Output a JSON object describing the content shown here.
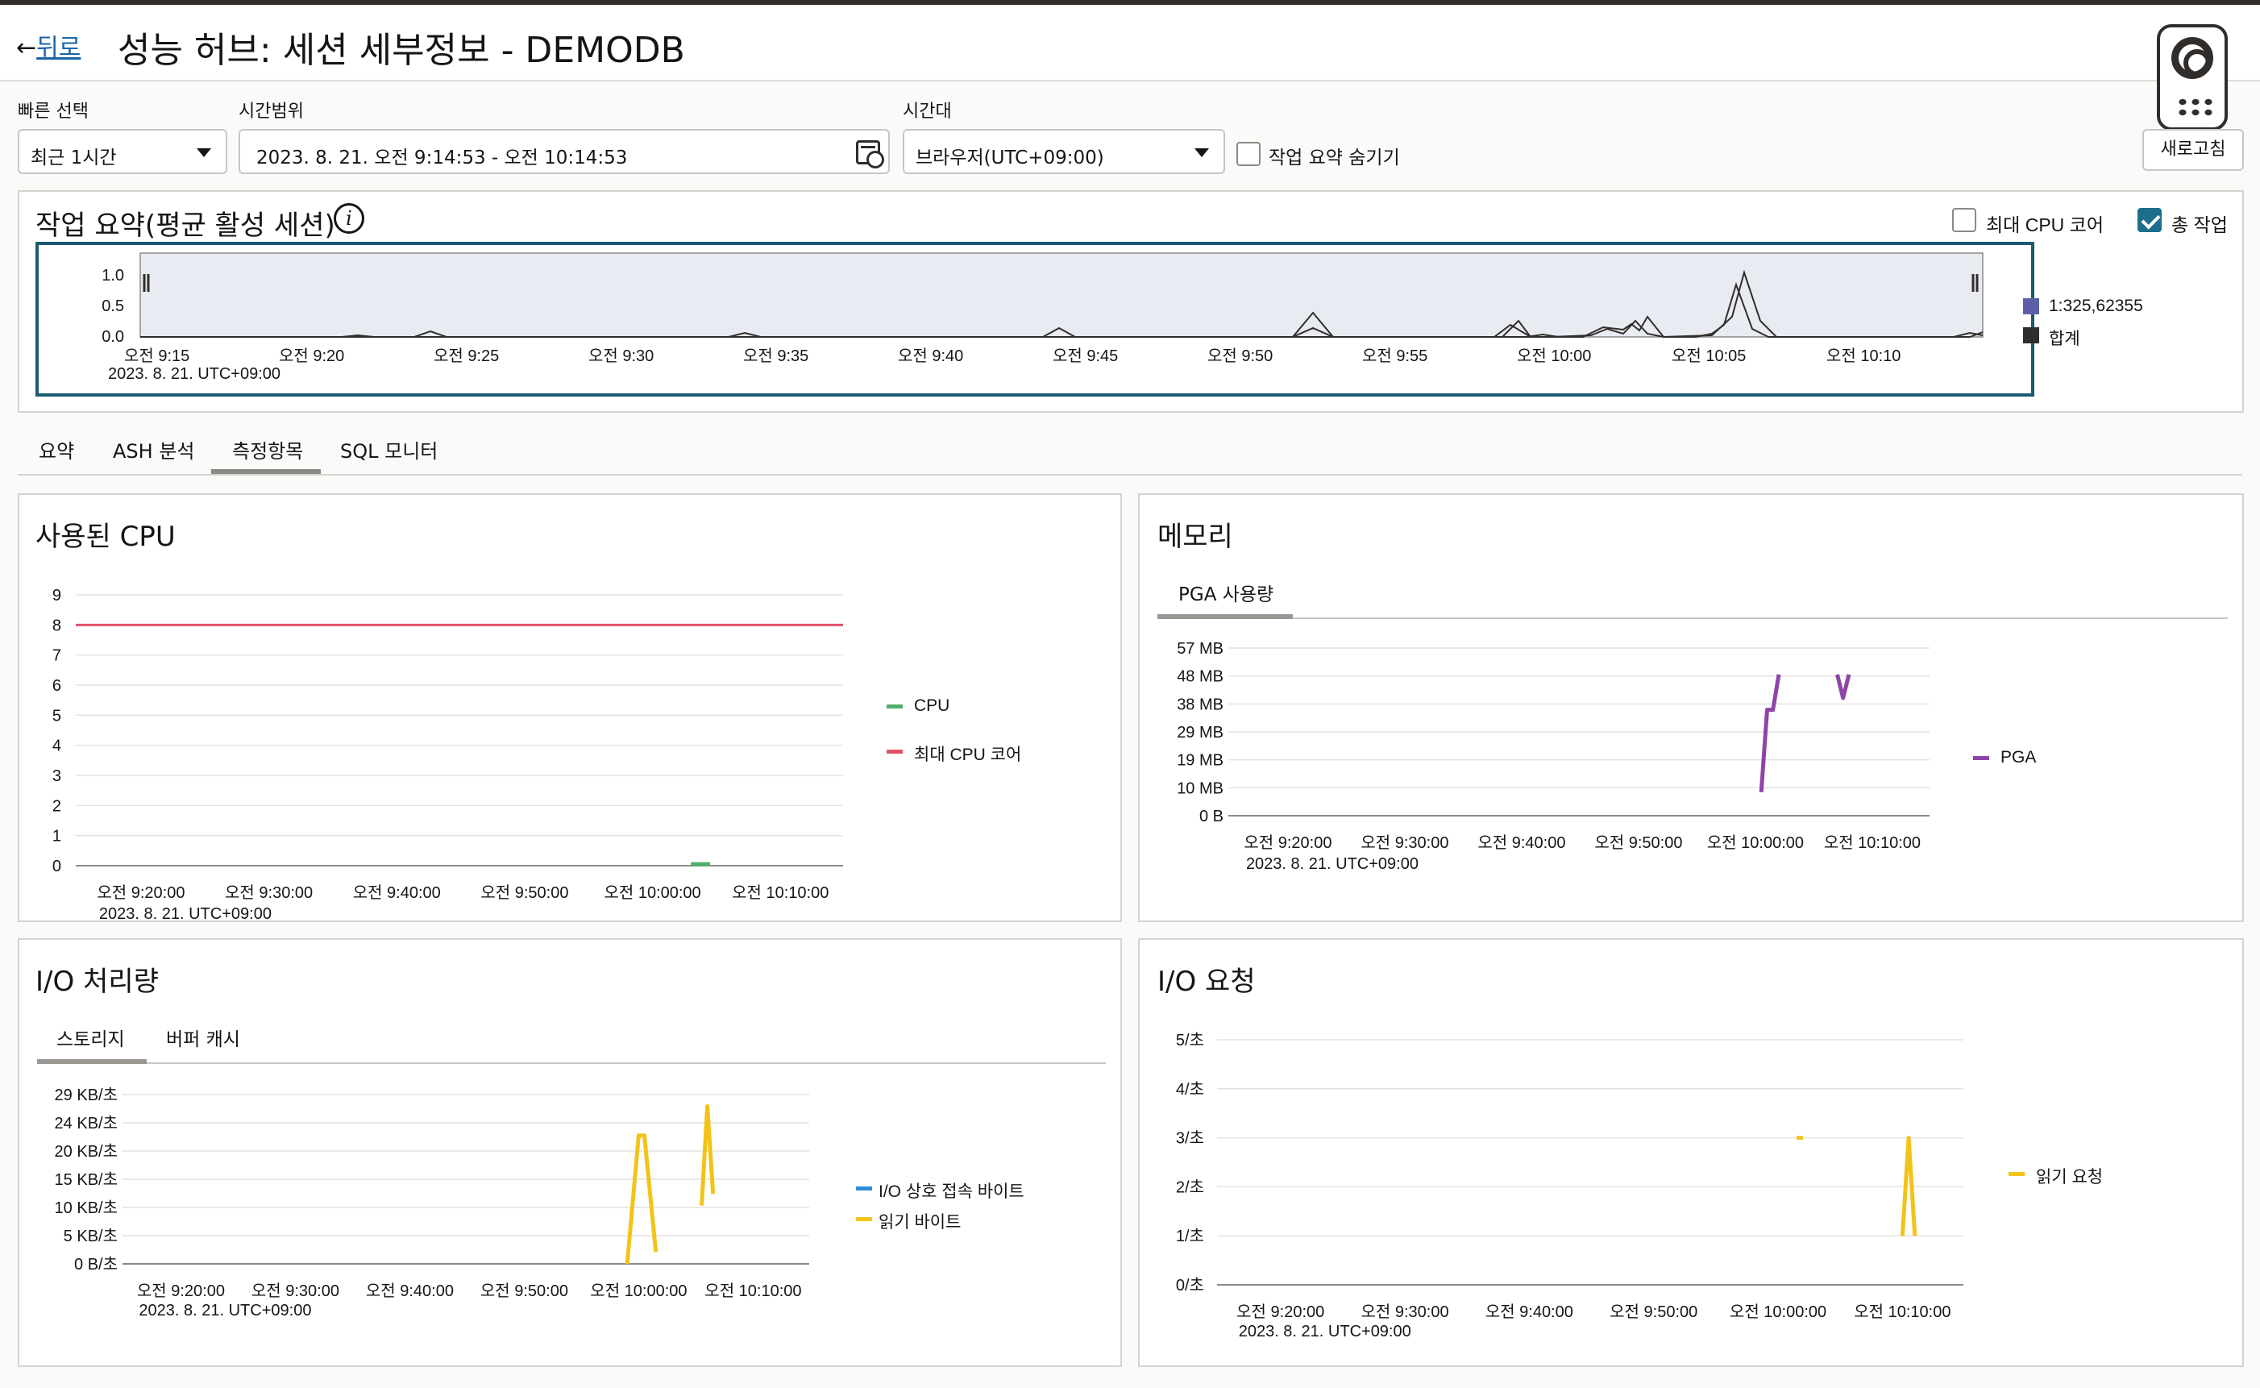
{
  "header": {
    "back_arrow": "←",
    "back_label": "뒤로",
    "title": "성능 허브: 세션 세부정보 - DEMODB"
  },
  "filters": {
    "quick_select_label": "빠른 선택",
    "quick_select_value": "최근 1시간",
    "time_range_label": "시간범위",
    "time_range_value": "2023. 8. 21. 오전 9:14:53 - 오전 10:14:53",
    "timezone_label": "시간대",
    "timezone_value": "브라우저(UTC+09:00)",
    "hide_summary_label": "작업 요약 숨기기",
    "refresh_label": "새로고침"
  },
  "summary": {
    "title": "작업 요약(평균 활성 세션)",
    "max_cpu_label": "최대 CPU 코어",
    "total_work_label": "총 작업",
    "y_ticks": [
      "1.0",
      "0.5",
      "0.0"
    ],
    "x_ticks": [
      "오전 9:15",
      "오전 9:20",
      "오전 9:25",
      "오전 9:30",
      "오전 9:35",
      "오전 9:40",
      "오전 9:45",
      "오전 9:50",
      "오전 9:55",
      "오전 10:00",
      "오전 10:05",
      "오전 10:10"
    ],
    "date_label": "2023. 8. 21. UTC+09:00",
    "legend": [
      {
        "label": "1:325,62355",
        "color": "#5c5fa8"
      },
      {
        "label": "합계",
        "color": "#312d2a"
      }
    ]
  },
  "tabs": [
    {
      "label": "요약",
      "active": false
    },
    {
      "label": "ASH 분석",
      "active": false
    },
    {
      "label": "측정항목",
      "active": true
    },
    {
      "label": "SQL 모니터",
      "active": false
    }
  ],
  "cpu_panel": {
    "title": "사용된 CPU",
    "y_ticks": [
      "9",
      "8",
      "7",
      "6",
      "5",
      "4",
      "3",
      "2",
      "1",
      "0"
    ],
    "x_ticks": [
      "오전 9:20:00",
      "오전 9:30:00",
      "오전 9:40:00",
      "오전 9:50:00",
      "오전 10:00:00",
      "오전 10:10:00"
    ],
    "date_label": "2023. 8. 21. UTC+09:00",
    "legend": [
      {
        "label": "CPU",
        "color": "#4fb06d"
      },
      {
        "label": "최대 CPU 코어",
        "color": "#e0526a"
      }
    ]
  },
  "memory_panel": {
    "title": "메모리",
    "subtab": "PGA 사용량",
    "y_ticks": [
      "57 MB",
      "48 MB",
      "38 MB",
      "29 MB",
      "19 MB",
      "10 MB",
      "0 B"
    ],
    "x_ticks": [
      "오전 9:20:00",
      "오전 9:30:00",
      "오전 9:40:00",
      "오전 9:50:00",
      "오전 10:00:00",
      "오전 10:10:00"
    ],
    "date_label": "2023. 8. 21. UTC+09:00",
    "legend": [
      {
        "label": "PGA",
        "color": "#8e44a8"
      }
    ]
  },
  "io_throughput_panel": {
    "title": "I/O 처리량",
    "subtabs": [
      "스토리지",
      "버퍼 캐시"
    ],
    "y_ticks": [
      "29 KB/초",
      "24 KB/초",
      "20 KB/초",
      "15 KB/초",
      "10 KB/초",
      "5 KB/초",
      "0 B/초"
    ],
    "x_ticks": [
      "오전 9:20:00",
      "오전 9:30:00",
      "오전 9:40:00",
      "오전 9:50:00",
      "오전 10:00:00",
      "오전 10:10:00"
    ],
    "date_label": "2023. 8. 21. UTC+09:00",
    "legend": [
      {
        "label": "I/O 상호 접속 바이트",
        "color": "#2d8fd5"
      },
      {
        "label": "읽기 바이트",
        "color": "#f2c318"
      }
    ]
  },
  "io_requests_panel": {
    "title": "I/O 요청",
    "y_ticks": [
      "5/초",
      "4/초",
      "3/초",
      "2/초",
      "1/초",
      "0/초"
    ],
    "x_ticks": [
      "오전 9:20:00",
      "오전 9:30:00",
      "오전 9:40:00",
      "오전 9:50:00",
      "오전 10:00:00",
      "오전 10:10:00"
    ],
    "date_label": "2023. 8. 21. UTC+09:00",
    "legend": [
      {
        "label": "읽기 요청",
        "color": "#f2c318"
      }
    ]
  },
  "colors": {
    "accent": "#1d6e8c",
    "summary_fill": "#e8ebf2",
    "pga": "#8e44a8",
    "read": "#f2c318",
    "cpu": "#4fb06d",
    "max_cpu": "#e0526a"
  },
  "chart_data": [
    {
      "type": "line",
      "title": "사용된 CPU",
      "ylim": [
        0,
        9
      ],
      "series": [
        {
          "name": "최대 CPU 코어",
          "values": [
            8,
            8,
            8,
            8,
            8,
            8
          ]
        },
        {
          "name": "CPU",
          "x": [
            "오전 10:03:00",
            "오전 10:04:30"
          ],
          "values": [
            0.05,
            0.05
          ]
        }
      ]
    },
    {
      "type": "line",
      "title": "메모리",
      "ylim": [
        0,
        57
      ],
      "series": [
        {
          "name": "PGA",
          "x": [
            "오전 10:00:30",
            "오전 10:01:00",
            "오전 10:01:30",
            "오전 10:02:00",
            "오전 10:07:00",
            "오전 10:07:30",
            "오전 10:08:00"
          ],
          "values": [
            8,
            36,
            36,
            48,
            48,
            40,
            48
          ]
        }
      ]
    },
    {
      "type": "line",
      "title": "I/O 처리량",
      "ylim": [
        0,
        29
      ],
      "series": [
        {
          "name": "I/O 상호 접속 바이트",
          "values": []
        },
        {
          "name": "읽기 바이트",
          "x": [
            "오전 9:59:00",
            "오전 10:00:00",
            "오전 10:00:30",
            "오전 10:01:30",
            "오전 10:05:30",
            "오전 10:06:00",
            "오전 10:06:30"
          ],
          "values": [
            0,
            22,
            22,
            2,
            10,
            27,
            12
          ]
        }
      ]
    },
    {
      "type": "line",
      "title": "I/O 요청",
      "ylim": [
        0,
        5
      ],
      "series": [
        {
          "name": "읽기 요청",
          "x": [
            "오전 10:01:30",
            "오전 10:02:00",
            "오전 10:10:00",
            "오전 10:10:30",
            "오전 10:11:00"
          ],
          "values": [
            3,
            3,
            1,
            3,
            1
          ]
        }
      ]
    }
  ]
}
